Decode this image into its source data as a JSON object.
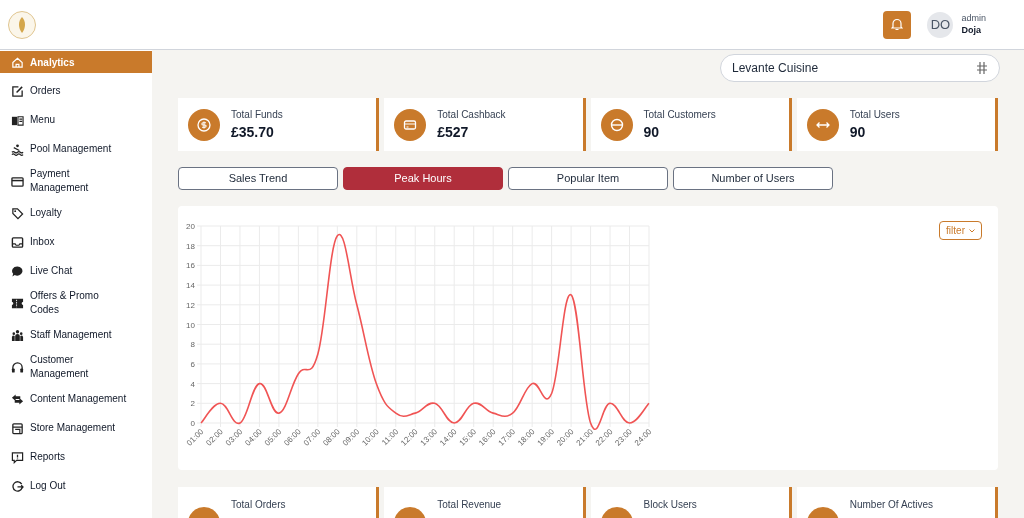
{
  "header": {
    "user_initials": "DO",
    "user_role": "admin",
    "user_name": "Doja"
  },
  "sidebar": {
    "items": [
      {
        "label": "Analytics",
        "selected": true
      },
      {
        "label": "Orders",
        "selected": false
      },
      {
        "label": "Menu",
        "selected": false
      },
      {
        "label": "Pool Management",
        "selected": false
      },
      {
        "label": "Payment Management",
        "selected": false
      },
      {
        "label": "Loyalty",
        "selected": false
      },
      {
        "label": "Inbox",
        "selected": false
      },
      {
        "label": "Live Chat",
        "selected": false
      },
      {
        "label": "Offers & Promo Codes",
        "selected": false
      },
      {
        "label": "Staff Management",
        "selected": false
      },
      {
        "label": "Customer Management",
        "selected": false
      },
      {
        "label": "Content Management",
        "selected": false
      },
      {
        "label": "Store Management",
        "selected": false
      },
      {
        "label": "Reports",
        "selected": false
      },
      {
        "label": "Log Out",
        "selected": false
      }
    ]
  },
  "restaurant_select": {
    "value": "Levante Cuisine"
  },
  "stats": [
    {
      "label": "Total Funds",
      "value": "£35.70"
    },
    {
      "label": "Total Cashback",
      "value": "£527"
    },
    {
      "label": "Total Customers",
      "value": "90"
    },
    {
      "label": "Total Users",
      "value": "90"
    }
  ],
  "tabs": [
    {
      "label": "Sales Trend",
      "selected": false
    },
    {
      "label": "Peak Hours",
      "selected": true
    },
    {
      "label": "Popular Item",
      "selected": false
    },
    {
      "label": "Number of Users",
      "selected": false
    }
  ],
  "filter_button": {
    "label": "filter"
  },
  "chart_data": {
    "type": "line",
    "categories": [
      "01:00",
      "02:00",
      "03:00",
      "04:00",
      "05:00",
      "06:00",
      "07:00",
      "08:00",
      "09:00",
      "10:00",
      "11:00",
      "12:00",
      "13:00",
      "14:00",
      "15:00",
      "16:00",
      "17:00",
      "18:00",
      "19:00",
      "20:00",
      "21:00",
      "22:00",
      "23:00",
      "24:00"
    ],
    "grid": true,
    "series": [
      {
        "color": "#f05454",
        "values": [
          0,
          2,
          0,
          4,
          1,
          5,
          7,
          19,
          12,
          4,
          1,
          1,
          2,
          0,
          2,
          1,
          1,
          4,
          3,
          13,
          0,
          2,
          0,
          2
        ]
      }
    ],
    "ylim": [
      0,
      20
    ],
    "yticks": [
      0,
      2,
      4,
      6,
      8,
      10,
      12,
      14,
      16,
      18,
      20
    ]
  },
  "bottom_stats": [
    {
      "label": "Total Orders"
    },
    {
      "label": "Total Revenue"
    },
    {
      "label": "Block Users"
    },
    {
      "label": "Number Of Actives"
    }
  ]
}
